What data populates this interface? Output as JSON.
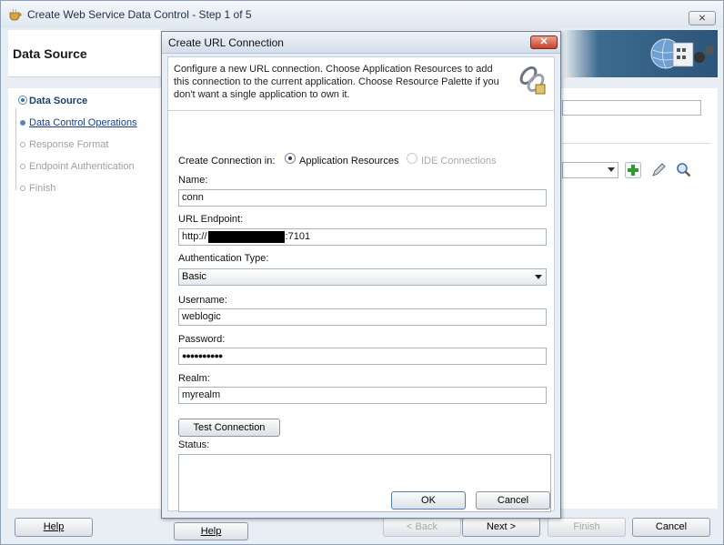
{
  "outer": {
    "title": "Create Web Service Data Control - Step 1 of 5",
    "close_label": "⨯",
    "banner_title": "Data Source",
    "nav": [
      {
        "label": "Data Source",
        "state": "current"
      },
      {
        "label": "Data Control Operations",
        "state": "link"
      },
      {
        "label": "Response Format",
        "state": "dim"
      },
      {
        "label": "Endpoint Authentication",
        "state": "dim"
      },
      {
        "label": "Finish",
        "state": "dim"
      }
    ],
    "buttons": {
      "help": "Help",
      "back": "< Back",
      "next": "Next >",
      "finish": "Finish",
      "cancel": "Cancel"
    }
  },
  "dialog": {
    "title": "Create URL Connection",
    "close_label": "✕",
    "description": "Configure a new URL connection.  Choose Application Resources to add this connection to the current application. Choose Resource Palette if you don't want a single application to own it.",
    "create_in_label": "Create Connection in:",
    "radio_app": "Application Resources",
    "radio_ide": "IDE Connections",
    "name_label": "Name:",
    "name_value": "conn",
    "url_label": "URL Endpoint:",
    "url_prefix": "http://",
    "url_suffix": ":7101",
    "auth_label": "Authentication Type:",
    "auth_value": "Basic",
    "username_label": "Username:",
    "username_value": "weblogic",
    "password_label": "Password:",
    "password_value": "●●●●●●●●●●",
    "realm_label": "Realm:",
    "realm_value": "myrealm",
    "test_button": "Test Connection",
    "status_label": "Status:",
    "help_button": "Help",
    "ok_button": "OK",
    "cancel_button": "Cancel"
  }
}
